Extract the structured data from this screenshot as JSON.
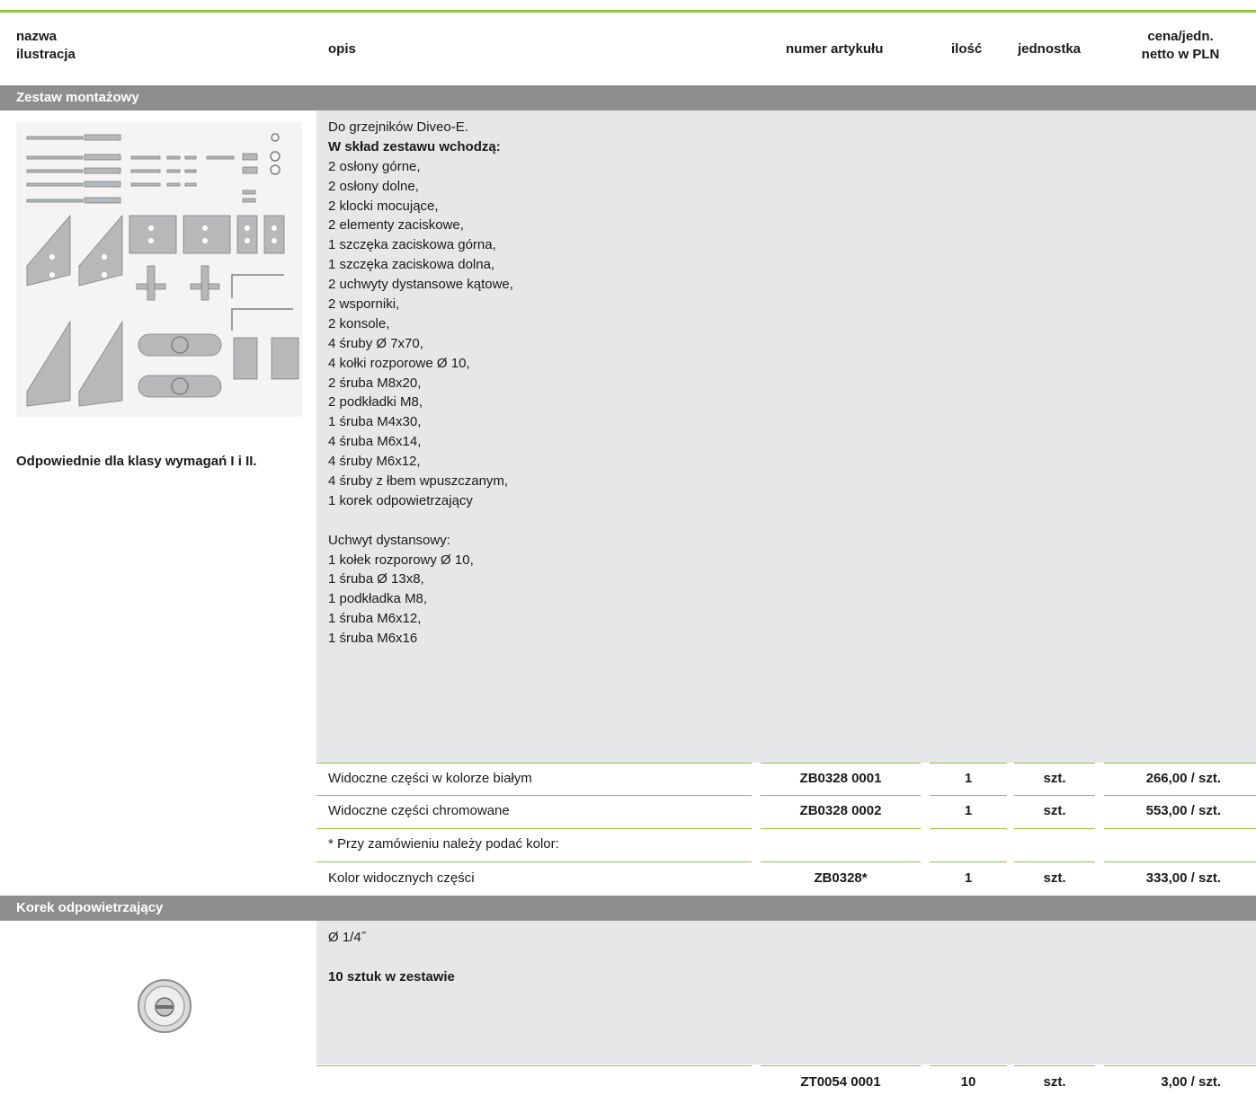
{
  "header": {
    "col_name_line1": "nazwa",
    "col_name_line2": "ilustracja",
    "col_desc": "opis",
    "col_article": "numer artykułu",
    "col_qty": "ilość",
    "col_unit": "jednostka",
    "col_price_line1": "cena/jedn.",
    "col_price_line2": "netto w PLN"
  },
  "section1": {
    "title": "Zestaw montażowy",
    "note": "Odpowiednie dla klasy wymagań I i II.",
    "description": [
      "Do grzejników Diveo-E.",
      "W skład zestawu wchodzą:",
      "2 osłony górne,",
      "2 osłony dolne,",
      "2 klocki mocujące,",
      "2 elementy zaciskowe,",
      "1 szczęka zaciskowa górna,",
      "1 szczęka zaciskowa dolna,",
      "2 uchwyty dystansowe kątowe,",
      "2 wsporniki,",
      "2 konsole,",
      "4 śruby Ø 7x70,",
      "4 kołki rozporowe Ø 10,",
      "2 śruba M8x20,",
      "2 podkładki M8,",
      "1 śruba M4x30,",
      "4 śruba M6x14,",
      "4 śruby M6x12,",
      "4 śruby z łbem wpuszczanym,",
      "1 korek odpowietrzający",
      "",
      "Uchwyt dystansowy:",
      "1 kołek rozporowy Ø 10,",
      "1 śruba Ø 13x8,",
      "1 podkładka M8,",
      "1 śruba M6x12,",
      "1 śruba M6x16"
    ],
    "rows": [
      {
        "desc": "Widoczne części w kolorze białym",
        "article": "ZB0328 0001",
        "qty": "1",
        "unit": "szt.",
        "price": "266,00 / szt."
      },
      {
        "desc": "Widoczne części chromowane",
        "article": "ZB0328 0002",
        "qty": "1",
        "unit": "szt.",
        "price": "553,00 / szt."
      },
      {
        "desc": "* Przy zamówieniu należy podać kolor:",
        "article": "",
        "qty": "",
        "unit": "",
        "price": ""
      },
      {
        "desc": "Kolor widocznych części",
        "article": "ZB0328*",
        "qty": "1",
        "unit": "szt.",
        "price": "333,00 / szt."
      }
    ]
  },
  "section2": {
    "title": "Korek odpowietrzający",
    "description": [
      "Ø 1/4˝",
      "",
      "10 sztuk w zestawie"
    ],
    "rows": [
      {
        "desc": "",
        "article": "ZT0054 0001",
        "qty": "10",
        "unit": "szt.",
        "price": "3,00 / szt."
      }
    ]
  },
  "colors": {
    "accent_green": "#8dc63f",
    "section_gray": "#8c8f8e",
    "panel_gray": "#e6e7e8"
  }
}
